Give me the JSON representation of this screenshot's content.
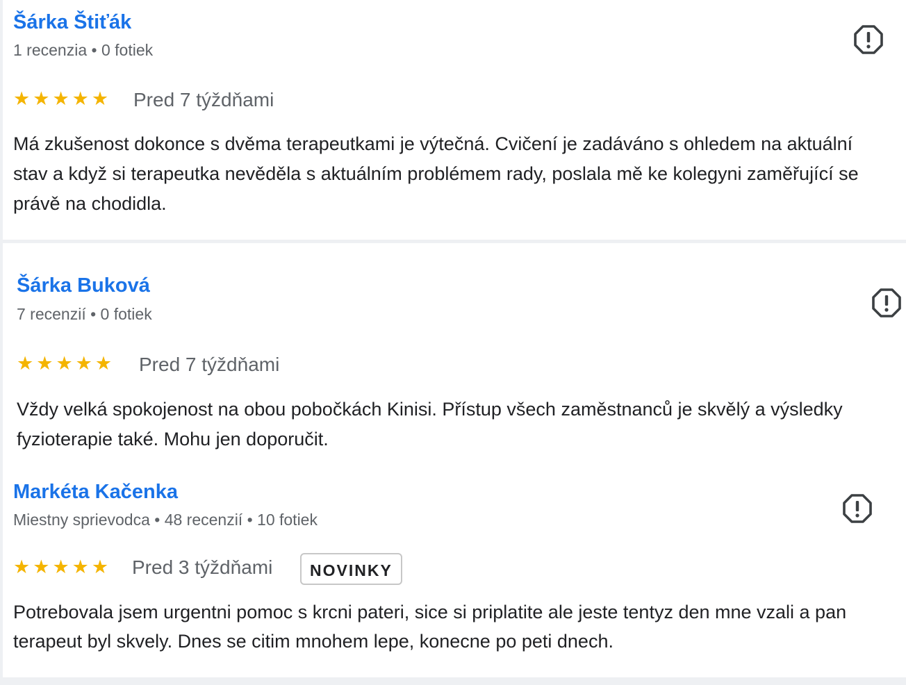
{
  "reviews": [
    {
      "author": "Šárka Štiťák",
      "meta": "1 recenzia • 0 fotiek",
      "rating": 5,
      "stars": "★★★★★",
      "date": "Pred 7 týždňami",
      "text": "Má zkušenost dokonce s dvěma terapeutkami je výtečná. Cvičení je zadáváno s ohledem na aktuální stav a když si terapeutka nevěděla s aktuálním problémem rady, poslala mě ke kolegyni zaměřující se právě na chodidla."
    },
    {
      "author": "Šárka Buková",
      "meta": "7 recenzií • 0 fotiek",
      "rating": 5,
      "stars": "★★★★★",
      "date": "Pred 7 týždňami",
      "text": "Vždy velká spokojenost na obou pobočkách Kinisi. Přístup všech zaměstnanců je skvělý a výsledky fyzioterapie také. Mohu jen doporučit."
    },
    {
      "author": "Markéta Kačenka",
      "meta": "Miestny sprievodca • 48 recenzií • 10 fotiek",
      "rating": 5,
      "stars": "★★★★★",
      "date": "Pred 3 týždňami",
      "badge": "NOVINKY",
      "text": "Potrebovala jsem urgentni pomoc s krcni pateri, sice si priplatite ale jeste tentyz den mne vzali a pan terapeut byl skvely. Dnes se citim mnohem lepe, konecne po peti dnech."
    }
  ],
  "icons": {
    "report": "report-flag-icon",
    "star": "star-icon"
  },
  "colors": {
    "author_link": "#1a73e8",
    "star": "#f4b400",
    "meta_text": "#5f6368",
    "body_text": "#202124"
  }
}
